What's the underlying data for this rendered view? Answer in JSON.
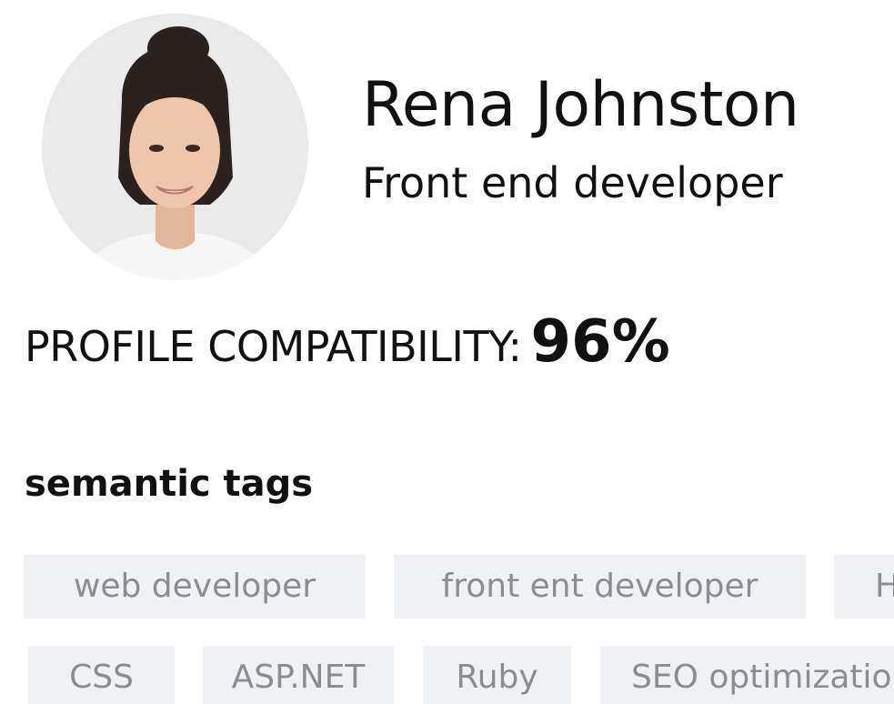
{
  "profile": {
    "name": "Rena Johnston",
    "role": "Front end developer",
    "compatibility_label": "PROFILE COMPATIBILITY:",
    "compatibility_value": "96%"
  },
  "tags_section": {
    "heading": "semantic tags",
    "tags": [
      "web developer",
      "front ent developer",
      "H",
      "CSS",
      "ASP.NET",
      "Ruby",
      "SEO optimizatio"
    ]
  },
  "colors": {
    "tag_background": "#f0f1f4",
    "tag_text": "#8a8d94",
    "text": "#111111"
  }
}
